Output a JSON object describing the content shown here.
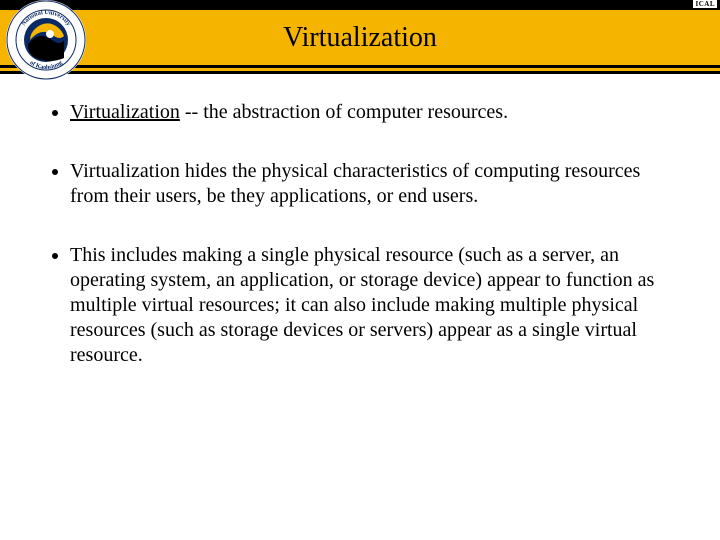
{
  "corner_tag": "ICAL",
  "title": "Virtualization",
  "bullets": {
    "b1_term": "Virtualization",
    "b1_rest": " -- the abstraction of computer resources.",
    "b2": "Virtualization hides the physical characteristics of computing resources from their users, be they applications, or end users.",
    "b3": "This includes making a single physical resource (such as a server, an operating system, an application, or storage device) appear to function as multiple virtual resources; it can also include making multiple physical resources (such as storage devices or servers) appear as a single virtual resource."
  },
  "logo": {
    "ring_text_top": "National University",
    "ring_text_bottom": "of Kaohsiung",
    "center_colors": {
      "outer": "#0a2a66",
      "inner_top": "#f5b400",
      "inner_bottom": "#000"
    }
  }
}
